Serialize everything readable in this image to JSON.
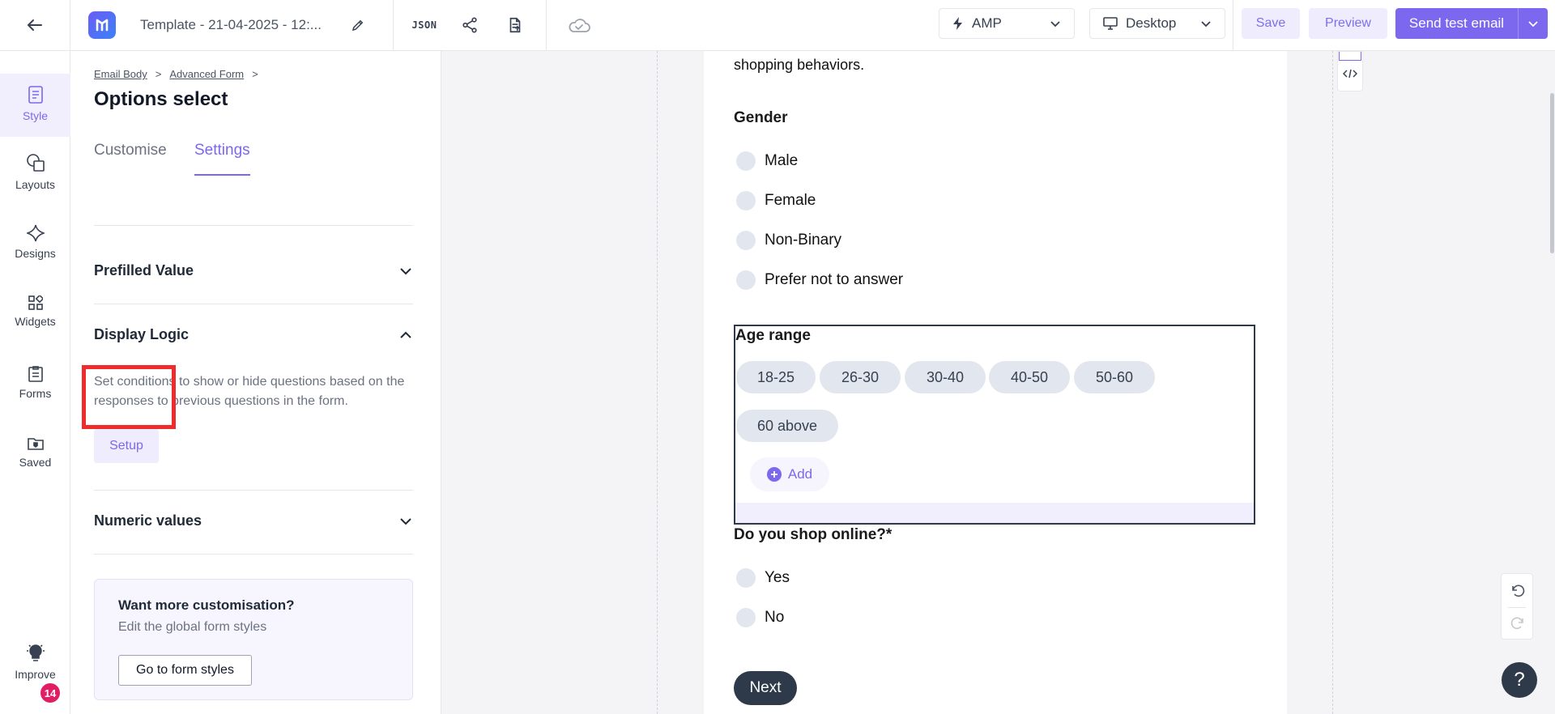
{
  "topbar": {
    "title": "Template - 21-04-2025 - 12:...",
    "json_label": "JSON",
    "format_value": "AMP",
    "device_value": "Desktop",
    "save_label": "Save",
    "preview_label": "Preview",
    "send_label": "Send test email"
  },
  "rail": {
    "items": [
      {
        "label": "Style",
        "icon": "style-icon"
      },
      {
        "label": "Layouts",
        "icon": "layouts-icon"
      },
      {
        "label": "Designs",
        "icon": "designs-icon"
      },
      {
        "label": "Widgets",
        "icon": "widgets-icon"
      },
      {
        "label": "Forms",
        "icon": "forms-icon"
      },
      {
        "label": "Saved",
        "icon": "saved-icon"
      }
    ],
    "improve_label": "Improve",
    "improve_badge": "14"
  },
  "panel": {
    "breadcrumb": [
      "Email Body",
      "Advanced Form"
    ],
    "breadcrumb_sep": ">",
    "title": "Options select",
    "tabs": [
      "Customise",
      "Settings"
    ],
    "active_tab": "Settings",
    "sections": {
      "prefilled": "Prefilled Value",
      "display_logic": "Display Logic",
      "display_logic_desc": "Set conditions to show or hide questions based on the responses to previous questions in the form.",
      "setup_label": "Setup",
      "numeric": "Numeric values"
    },
    "promo": {
      "title": "Want more customisation?",
      "subtitle": "Edit the global form styles",
      "button": "Go to form styles"
    }
  },
  "email": {
    "intro_tail": "shopping behaviors.",
    "gender_q": "Gender",
    "gender_options": [
      "Male",
      "Female",
      "Non-Binary",
      "Prefer not to answer"
    ],
    "age_q": "Age range",
    "age_options": [
      "18-25",
      "26-30",
      "30-40",
      "40-50",
      "50-60",
      "60 above"
    ],
    "add_label": "Add",
    "shop_q": "Do you shop online?*",
    "shop_options": [
      "Yes",
      "No"
    ],
    "next_label": "Next"
  },
  "help_label": "?",
  "colors": {
    "accent": "#7b68ee",
    "highlight": "#ef2b2b",
    "dark": "#2e3a4a"
  }
}
